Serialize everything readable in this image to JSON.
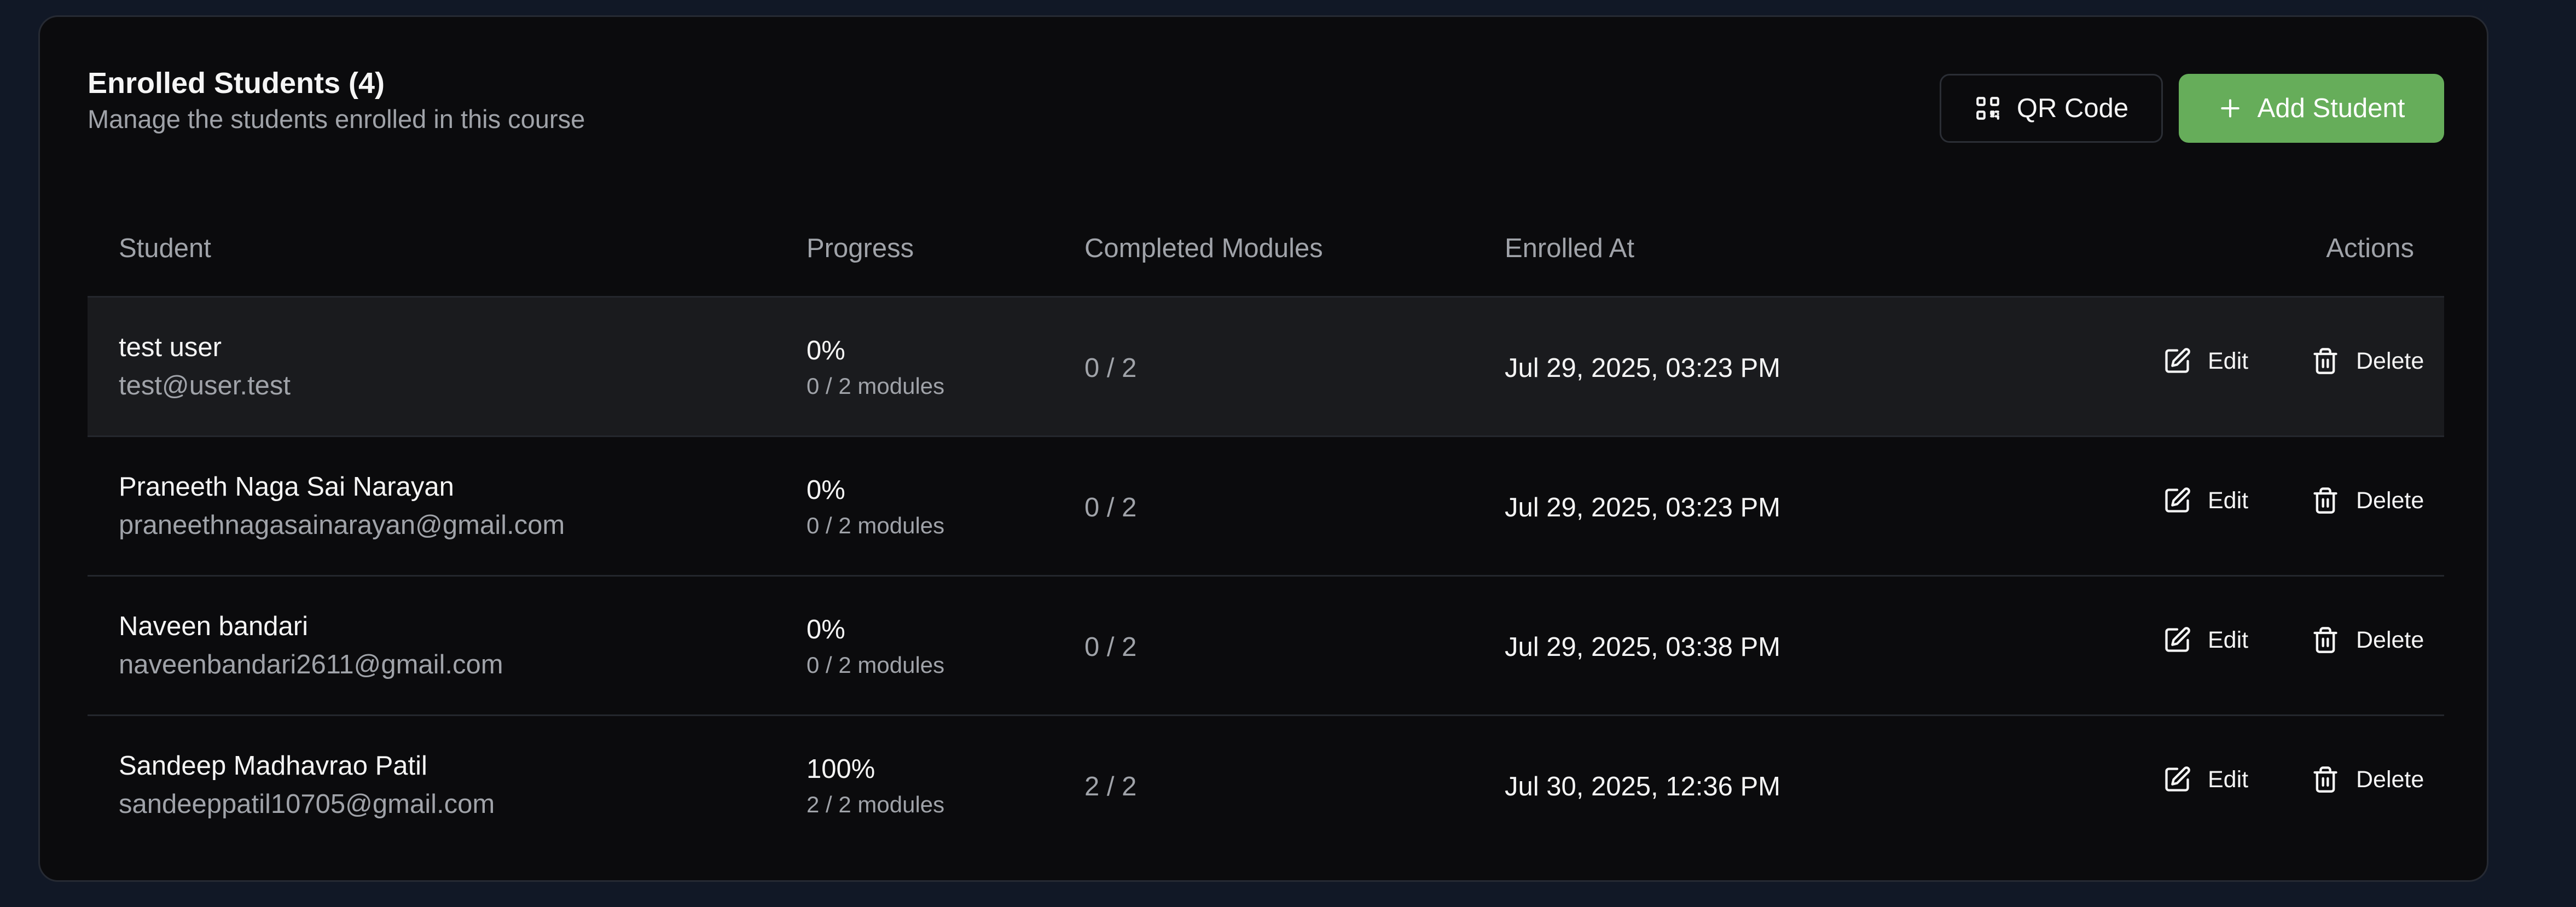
{
  "header": {
    "title": "Enrolled Students (4)",
    "subtitle": "Manage the students enrolled in this course",
    "qr_label": "QR Code",
    "add_label": "Add Student"
  },
  "columns": {
    "student": "Student",
    "progress": "Progress",
    "completed": "Completed Modules",
    "enrolled": "Enrolled At",
    "actions": "Actions"
  },
  "actions": {
    "edit": "Edit",
    "delete": "Delete"
  },
  "rows": [
    {
      "name": "test user",
      "email": "test@user.test",
      "progress": "0%",
      "modules": "0 / 2 modules",
      "completed": "0 / 2",
      "enrolled_at": "Jul 29, 2025, 03:23 PM"
    },
    {
      "name": "Praneeth Naga Sai Narayan",
      "email": "praneethnagasainarayan@gmail.com",
      "progress": "0%",
      "modules": "0 / 2 modules",
      "completed": "0 / 2",
      "enrolled_at": "Jul 29, 2025, 03:23 PM"
    },
    {
      "name": "Naveen bandari",
      "email": "naveenbandari2611@gmail.com",
      "progress": "0%",
      "modules": "0 / 2 modules",
      "completed": "0 / 2",
      "enrolled_at": "Jul 29, 2025, 03:38 PM"
    },
    {
      "name": "Sandeep Madhavrao Patil",
      "email": "sandeeppatil10705@gmail.com",
      "progress": "100%",
      "modules": "2 / 2 modules",
      "completed": "2 / 2",
      "enrolled_at": "Jul 30, 2025, 12:36 PM"
    }
  ],
  "colors": {
    "accent": "#66ad5a",
    "card_bg": "#0b0b0d",
    "page_bg": "#111826",
    "hover_row": "#1a1b1e"
  }
}
